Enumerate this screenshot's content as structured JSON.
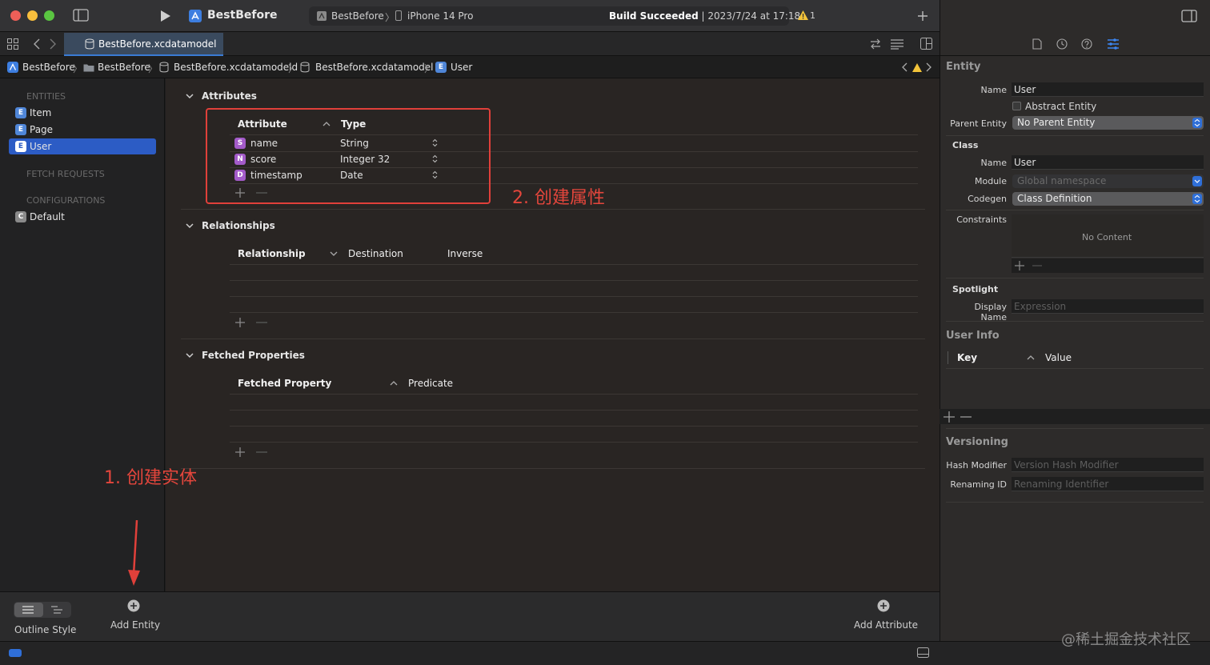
{
  "toolbar": {
    "project_name": "BestBefore",
    "scheme": "BestBefore",
    "device": "iPhone 14 Pro",
    "build_status_bold": "Build Succeeded",
    "build_status_rest": " | 2023/7/24 at 17:18",
    "warning_count": "1"
  },
  "tab": {
    "file_name": "BestBefore.xcdatamodel"
  },
  "breadcrumb": [
    "BestBefore",
    "BestBefore",
    "BestBefore.xcdatamodeld",
    "BestBefore.xcdatamodel",
    "User"
  ],
  "sidebar": {
    "entities_header": "ENTITIES",
    "entities": [
      {
        "badge": "E",
        "label": "Item",
        "selected": false
      },
      {
        "badge": "E",
        "label": "Page",
        "selected": false
      },
      {
        "badge": "E",
        "label": "User",
        "selected": true
      }
    ],
    "fetch_header": "FETCH REQUESTS",
    "config_header": "CONFIGURATIONS",
    "configurations": [
      {
        "badge": "C",
        "label": "Default"
      }
    ]
  },
  "attributes": {
    "title": "Attributes",
    "col_attribute": "Attribute",
    "col_type": "Type",
    "rows": [
      {
        "badge": "S",
        "name": "name",
        "type": "String"
      },
      {
        "badge": "N",
        "name": "score",
        "type": "Integer 32"
      },
      {
        "badge": "D",
        "name": "timestamp",
        "type": "Date"
      }
    ]
  },
  "relationships": {
    "title": "Relationships",
    "col_relationship": "Relationship",
    "col_destination": "Destination",
    "col_inverse": "Inverse"
  },
  "fetched": {
    "title": "Fetched Properties",
    "col_property": "Fetched Property",
    "col_predicate": "Predicate"
  },
  "annotations": {
    "attr_note": "2. 创建属性",
    "entity_note": "1. 创建实体"
  },
  "bottombar": {
    "outline_style": "Outline Style",
    "add_entity": "Add Entity",
    "add_attribute": "Add Attribute"
  },
  "inspector": {
    "entity_header": "Entity",
    "name_label": "Name",
    "name_value": "User",
    "abstract_label": "Abstract Entity",
    "parent_label": "Parent Entity",
    "parent_value": "No Parent Entity",
    "class_header": "Class",
    "class_name_label": "Name",
    "class_name_value": "User",
    "module_label": "Module",
    "module_value": "Global namespace",
    "codegen_label": "Codegen",
    "codegen_value": "Class Definition",
    "constraints_label": "Constraints",
    "constraints_empty": "No Content",
    "spotlight_header": "Spotlight",
    "display_name_label": "Display Name",
    "display_name_placeholder": "Expression",
    "userinfo_header": "User Info",
    "key_label": "Key",
    "value_label": "Value",
    "versioning_header": "Versioning",
    "hash_label": "Hash Modifier",
    "hash_placeholder": "Version Hash Modifier",
    "renaming_label": "Renaming ID",
    "renaming_placeholder": "Renaming Identifier"
  },
  "watermark": "@稀土掘金技术社区",
  "colors": {
    "accent": "#2c5cc5",
    "annotation": "#e0403a",
    "attribute_badge": "#a35bc9"
  }
}
